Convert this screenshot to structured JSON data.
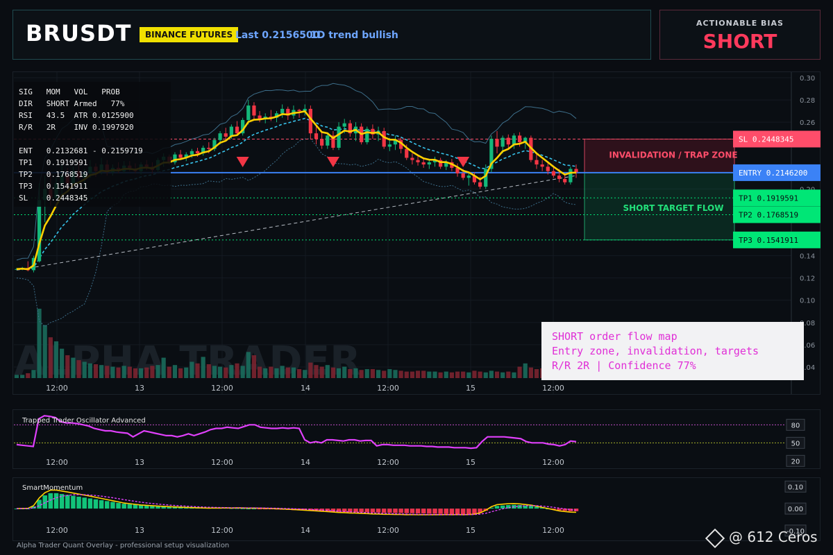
{
  "header": {
    "symbol": "BRUSDT",
    "exchange": "BINANCE FUTURES",
    "last_price": "Last 0.2156500",
    "trend": "1D trend bullish",
    "bias_label": "ACTIONABLE BIAS",
    "bias_value": "SHORT"
  },
  "colors": {
    "bull": "#14b87a",
    "bear": "#f23645",
    "ema": "#ffd000",
    "band": "#3d6e8a",
    "vwap": "#38c4ec",
    "entry": "#3b82f6",
    "stop": "#ff4d6a",
    "target": "#00e676",
    "oscillator": "#e040fb"
  },
  "info_panel": {
    "rows": [
      "SIG   MOM   VOL   PROB",
      "DIR   SHORT Armed   77%",
      "RSI   43.5  ATR 0.0125900",
      "R/R   2R    INV 0.1997920",
      "",
      "ENT   0.2132681 - 0.2159719",
      "TP1   0.1919591",
      "TP2   0.1768519",
      "TP3   0.1541911",
      "SL    0.2448345"
    ]
  },
  "note": {
    "lines": [
      "SHORT order flow map",
      "Entry zone, invalidation, targets",
      "R/R 2R | Confidence 77%"
    ]
  },
  "footer": "Alpha Trader Quant Overlay - professional setup visualization",
  "credit": "@ 612 Ceros",
  "chart_data": [
    {
      "type": "candlestick",
      "ylim": [
        0.03,
        0.3
      ],
      "y_ticks": [
        0.3,
        0.28,
        0.26,
        0.2,
        0.14,
        0.12,
        0.1,
        0.08,
        0.06,
        0.04
      ],
      "x_ticks": [
        "12:00",
        "13",
        "12:00",
        "14",
        "12:00",
        "15",
        "12:00"
      ],
      "watermark": "ALPHA TRADER",
      "ohlc": [
        [
          0.128,
          0.129,
          0.127,
          0.128
        ],
        [
          0.128,
          0.13,
          0.127,
          0.129
        ],
        [
          0.129,
          0.135,
          0.126,
          0.127
        ],
        [
          0.127,
          0.14,
          0.125,
          0.138
        ],
        [
          0.135,
          0.205,
          0.134,
          0.19
        ],
        [
          0.19,
          0.212,
          0.17,
          0.2
        ],
        [
          0.2,
          0.215,
          0.185,
          0.192
        ],
        [
          0.192,
          0.21,
          0.19,
          0.205
        ],
        [
          0.205,
          0.222,
          0.195,
          0.212
        ],
        [
          0.212,
          0.219,
          0.2,
          0.205
        ],
        [
          0.205,
          0.22,
          0.203,
          0.216
        ],
        [
          0.216,
          0.225,
          0.208,
          0.21
        ],
        [
          0.21,
          0.218,
          0.202,
          0.214
        ],
        [
          0.214,
          0.226,
          0.21,
          0.22
        ],
        [
          0.22,
          0.223,
          0.211,
          0.216
        ],
        [
          0.216,
          0.228,
          0.213,
          0.222
        ],
        [
          0.222,
          0.226,
          0.212,
          0.215
        ],
        [
          0.215,
          0.222,
          0.212,
          0.219
        ],
        [
          0.219,
          0.224,
          0.214,
          0.216
        ],
        [
          0.216,
          0.225,
          0.214,
          0.221
        ],
        [
          0.221,
          0.225,
          0.216,
          0.218
        ],
        [
          0.218,
          0.223,
          0.214,
          0.216
        ],
        [
          0.216,
          0.224,
          0.213,
          0.222
        ],
        [
          0.222,
          0.226,
          0.217,
          0.22
        ],
        [
          0.22,
          0.224,
          0.214,
          0.217
        ],
        [
          0.217,
          0.228,
          0.215,
          0.226
        ],
        [
          0.226,
          0.232,
          0.22,
          0.229
        ],
        [
          0.229,
          0.231,
          0.222,
          0.224
        ],
        [
          0.224,
          0.233,
          0.222,
          0.231
        ],
        [
          0.231,
          0.235,
          0.226,
          0.228
        ],
        [
          0.228,
          0.233,
          0.225,
          0.231
        ],
        [
          0.231,
          0.236,
          0.228,
          0.234
        ],
        [
          0.234,
          0.237,
          0.229,
          0.232
        ],
        [
          0.232,
          0.239,
          0.23,
          0.237
        ],
        [
          0.237,
          0.242,
          0.232,
          0.236
        ],
        [
          0.236,
          0.246,
          0.234,
          0.244
        ],
        [
          0.244,
          0.252,
          0.24,
          0.25
        ],
        [
          0.25,
          0.255,
          0.244,
          0.247
        ],
        [
          0.247,
          0.258,
          0.245,
          0.256
        ],
        [
          0.256,
          0.261,
          0.248,
          0.25
        ],
        [
          0.25,
          0.264,
          0.248,
          0.262
        ],
        [
          0.262,
          0.28,
          0.258,
          0.275
        ],
        [
          0.275,
          0.278,
          0.262,
          0.266
        ],
        [
          0.266,
          0.27,
          0.26,
          0.263
        ],
        [
          0.263,
          0.268,
          0.259,
          0.265
        ],
        [
          0.265,
          0.271,
          0.261,
          0.264
        ],
        [
          0.264,
          0.27,
          0.26,
          0.268
        ],
        [
          0.268,
          0.276,
          0.264,
          0.272
        ],
        [
          0.272,
          0.274,
          0.262,
          0.266
        ],
        [
          0.266,
          0.275,
          0.263,
          0.271
        ],
        [
          0.271,
          0.272,
          0.264,
          0.27
        ],
        [
          0.27,
          0.276,
          0.266,
          0.272
        ],
        [
          0.272,
          0.275,
          0.245,
          0.25
        ],
        [
          0.25,
          0.258,
          0.24,
          0.245
        ],
        [
          0.245,
          0.252,
          0.236,
          0.239
        ],
        [
          0.239,
          0.25,
          0.236,
          0.248
        ],
        [
          0.248,
          0.252,
          0.235,
          0.237
        ],
        [
          0.237,
          0.26,
          0.235,
          0.256
        ],
        [
          0.256,
          0.263,
          0.25,
          0.259
        ],
        [
          0.259,
          0.262,
          0.247,
          0.25
        ],
        [
          0.25,
          0.26,
          0.243,
          0.256
        ],
        [
          0.256,
          0.259,
          0.24,
          0.242
        ],
        [
          0.242,
          0.256,
          0.24,
          0.254
        ],
        [
          0.254,
          0.258,
          0.245,
          0.249
        ],
        [
          0.249,
          0.256,
          0.243,
          0.252
        ],
        [
          0.252,
          0.255,
          0.236,
          0.238
        ],
        [
          0.238,
          0.246,
          0.234,
          0.24
        ],
        [
          0.24,
          0.248,
          0.235,
          0.244
        ],
        [
          0.244,
          0.246,
          0.232,
          0.236
        ],
        [
          0.236,
          0.24,
          0.226,
          0.228
        ],
        [
          0.228,
          0.232,
          0.222,
          0.226
        ],
        [
          0.226,
          0.23,
          0.221,
          0.224
        ],
        [
          0.224,
          0.228,
          0.219,
          0.222
        ],
        [
          0.222,
          0.226,
          0.218,
          0.224
        ],
        [
          0.224,
          0.229,
          0.22,
          0.226
        ],
        [
          0.226,
          0.228,
          0.218,
          0.22
        ],
        [
          0.22,
          0.226,
          0.217,
          0.224
        ],
        [
          0.224,
          0.227,
          0.216,
          0.219
        ],
        [
          0.219,
          0.223,
          0.211,
          0.214
        ],
        [
          0.214,
          0.218,
          0.208,
          0.21
        ],
        [
          0.21,
          0.214,
          0.203,
          0.212
        ],
        [
          0.212,
          0.215,
          0.204,
          0.206
        ],
        [
          0.206,
          0.211,
          0.2,
          0.202
        ],
        [
          0.202,
          0.222,
          0.2,
          0.218
        ],
        [
          0.218,
          0.248,
          0.215,
          0.245
        ],
        [
          0.245,
          0.252,
          0.232,
          0.238
        ],
        [
          0.238,
          0.248,
          0.232,
          0.246
        ],
        [
          0.246,
          0.249,
          0.236,
          0.24
        ],
        [
          0.24,
          0.25,
          0.236,
          0.248
        ],
        [
          0.248,
          0.251,
          0.238,
          0.242
        ],
        [
          0.242,
          0.247,
          0.236,
          0.246
        ],
        [
          0.246,
          0.248,
          0.224,
          0.226
        ],
        [
          0.226,
          0.232,
          0.218,
          0.222
        ],
        [
          0.222,
          0.226,
          0.216,
          0.22
        ],
        [
          0.22,
          0.224,
          0.213,
          0.216
        ],
        [
          0.216,
          0.221,
          0.21,
          0.212
        ],
        [
          0.212,
          0.218,
          0.206,
          0.209
        ],
        [
          0.209,
          0.214,
          0.204,
          0.206
        ],
        [
          0.206,
          0.22,
          0.204,
          0.218
        ],
        [
          0.218,
          0.222,
          0.21,
          0.215
        ]
      ],
      "volume": [
        0.4,
        0.4,
        0.6,
        1.0,
        8.5,
        6.5,
        5.0,
        4.5,
        3.6,
        2.8,
        2.5,
        2.2,
        2.0,
        1.8,
        1.7,
        1.6,
        1.5,
        1.4,
        1.3,
        1.5,
        1.4,
        1.2,
        1.2,
        1.3,
        1.5,
        1.6,
        2.5,
        1.4,
        1.6,
        1.2,
        1.3,
        2.0,
        1.8,
        2.6,
        1.7,
        1.5,
        1.4,
        1.3,
        1.6,
        1.8,
        1.5,
        3.2,
        2.8,
        1.4,
        1.2,
        1.4,
        1.2,
        1.5,
        1.3,
        1.3,
        1.1,
        1.0,
        1.9,
        1.6,
        1.4,
        1.6,
        1.3,
        1.2,
        1.4,
        1.1,
        1.2,
        1.0,
        1.1,
        1.1,
        1.0,
        0.9,
        1.1,
        1.0,
        0.9,
        0.8,
        0.8,
        0.9,
        0.9,
        0.8,
        0.8,
        0.7,
        0.8,
        0.7,
        0.8,
        0.8,
        0.7,
        0.9,
        0.8,
        0.7,
        0.9,
        0.8,
        0.7,
        0.8,
        0.7,
        1.4,
        1.8,
        1.3,
        1.1,
        1.2,
        1.1,
        1.0,
        0.9,
        0.8,
        0.9,
        0.8
      ],
      "triangles_at": [
        40,
        56,
        79
      ],
      "levels": [
        {
          "label": "SL 0.2448345",
          "value": 0.2448345,
          "kind": "stop"
        },
        {
          "label": "ENTRY 0.2146200",
          "value": 0.21462,
          "kind": "entry"
        },
        {
          "label": "TP1 0.1919591",
          "value": 0.1919591,
          "kind": "target"
        },
        {
          "label": "TP2 0.1768519",
          "value": 0.1768519,
          "kind": "target"
        },
        {
          "label": "TP3 0.1541911",
          "value": 0.1541911,
          "kind": "target"
        }
      ],
      "zones": [
        {
          "label": "INVALIDATION / TRAP ZONE",
          "from": 0.21462,
          "to": 0.2448345,
          "kind": "stop"
        },
        {
          "label": "SHORT TARGET FLOW",
          "from": 0.1541911,
          "to": 0.21462,
          "kind": "target"
        }
      ]
    },
    {
      "type": "line",
      "title": "Trapped Trader Oscillator Advanced",
      "ylim": [
        10,
        100
      ],
      "y_ticks": [
        80,
        50,
        20
      ],
      "levels": [
        80,
        50
      ],
      "x_ticks": [
        "12:00",
        "13",
        "12:00",
        "14",
        "12:00",
        "15",
        "12:00"
      ],
      "series": [
        {
          "values": [
            47,
            46,
            45,
            44,
            90,
            95,
            94,
            92,
            85,
            83,
            83,
            82,
            80,
            78,
            74,
            72,
            70,
            70,
            68,
            67,
            66,
            60,
            65,
            70,
            68,
            66,
            64,
            62,
            62,
            60,
            62,
            65,
            62,
            65,
            68,
            72,
            74,
            74,
            76,
            75,
            74,
            77,
            80,
            80,
            76,
            75,
            74,
            74,
            75,
            74,
            75,
            74,
            55,
            50,
            52,
            50,
            55,
            55,
            54,
            53,
            55,
            55,
            53,
            54,
            54,
            45,
            47,
            47,
            46,
            46,
            46,
            45,
            45,
            45,
            44,
            44,
            43,
            43,
            43,
            42,
            42,
            42,
            41,
            42,
            52,
            60,
            60,
            60,
            60,
            59,
            58,
            57,
            52,
            50,
            50,
            50,
            48,
            47,
            45,
            47,
            53,
            52
          ]
        }
      ]
    },
    {
      "type": "bar",
      "title": "SmartMomentum",
      "ylim": [
        -0.11,
        0.12
      ],
      "y_ticks": [
        0.1,
        0.0,
        -0.1
      ],
      "x_ticks": [
        "12:00",
        "13",
        "12:00",
        "14",
        "12:00",
        "15",
        "12:00"
      ],
      "series": [
        {
          "values": [
            0.0,
            0.0,
            0.0,
            0.01,
            0.04,
            0.06,
            0.07,
            0.07,
            0.066,
            0.062,
            0.058,
            0.054,
            0.05,
            0.046,
            0.042,
            0.038,
            0.034,
            0.03,
            0.026,
            0.022,
            0.02,
            0.018,
            0.016,
            0.015,
            0.014,
            0.013,
            0.012,
            0.011,
            0.01,
            0.009,
            0.008,
            0.007,
            0.006,
            0.005,
            0.004,
            0.004,
            0.003,
            0.003,
            0.002,
            0.002,
            0.001,
            0.0,
            0.0,
            -0.001,
            -0.002,
            -0.003,
            -0.004,
            -0.005,
            -0.006,
            -0.007,
            -0.008,
            -0.009,
            -0.01,
            -0.011,
            -0.012,
            -0.013,
            -0.014,
            -0.015,
            -0.015,
            -0.016,
            -0.016,
            -0.017,
            -0.017,
            -0.018,
            -0.018,
            -0.019,
            -0.019,
            -0.02,
            -0.02,
            -0.021,
            -0.021,
            -0.022,
            -0.022,
            -0.023,
            -0.023,
            -0.024,
            -0.024,
            -0.025,
            -0.025,
            -0.026,
            -0.026,
            -0.025,
            -0.02,
            -0.01,
            0.004,
            0.012,
            0.014,
            0.016,
            0.017,
            0.016,
            0.014,
            0.012,
            0.008,
            0.004,
            0.0,
            -0.004,
            -0.008,
            -0.01,
            -0.012,
            -0.012
          ]
        }
      ]
    }
  ]
}
